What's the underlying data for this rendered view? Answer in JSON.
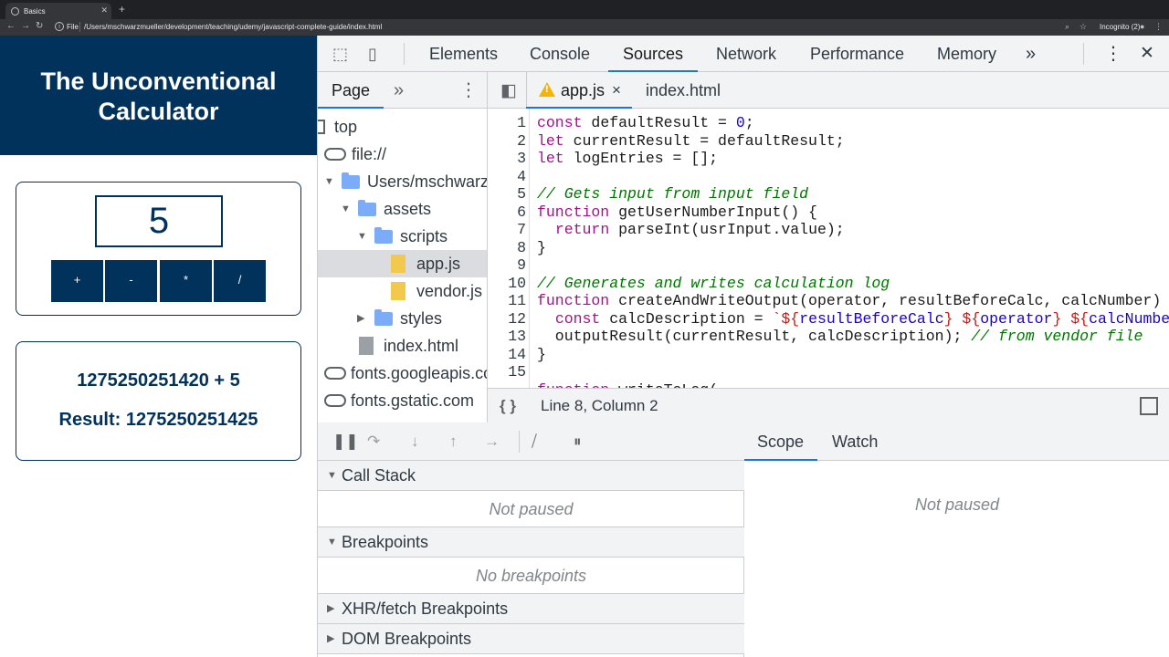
{
  "browser": {
    "tab_title": "Basics",
    "new_tab": "+",
    "file_label": "File",
    "url": "/Users/mschwarzmueller/development/teaching/udemy/javascript-complete-guide/index.html",
    "incognito": "Incognito (2)"
  },
  "app": {
    "title_line1": "The Unconventional",
    "title_line2": "Calculator",
    "input_value": "5",
    "buttons": [
      "+",
      "-",
      "*",
      "/"
    ],
    "calc_description": "1275250251420 + 5",
    "result": "Result: 1275250251425"
  },
  "devtools": {
    "tabs": [
      "Elements",
      "Console",
      "Sources",
      "Network",
      "Performance",
      "Memory"
    ],
    "active_tab": "Sources",
    "more": "»",
    "menu": "⋮",
    "close": "✕",
    "navigator": {
      "tab": "Page",
      "more": "»",
      "menu": "⋮",
      "tree": [
        "top",
        "file://",
        "Users/mschwarzmueller",
        "assets",
        "scripts",
        "app.js",
        "vendor.js",
        "styles",
        "index.html",
        "fonts.googleapis.com",
        "fonts.gstatic.com"
      ]
    },
    "editor": {
      "tabs": [
        "app.js",
        "index.html"
      ],
      "tab_close": "×",
      "line_numbers": [
        "1",
        "2",
        "3",
        "4",
        "5",
        "6",
        "7",
        "8",
        "9",
        "10",
        "11",
        "12",
        "13",
        "14",
        "15"
      ],
      "status": "Line 8, Column 2",
      "braces": "{ }"
    },
    "debugger": {
      "call_stack": "Call Stack",
      "call_stack_msg": "Not paused",
      "breakpoints": "Breakpoints",
      "breakpoints_msg": "No breakpoints",
      "xhr": "XHR/fetch Breakpoints",
      "dom": "DOM Breakpoints"
    },
    "scope": {
      "tabs": [
        "Scope",
        "Watch"
      ],
      "msg": "Not paused"
    }
  },
  "colors": {
    "brand": "#00325c",
    "accent": "#1a73e8"
  }
}
